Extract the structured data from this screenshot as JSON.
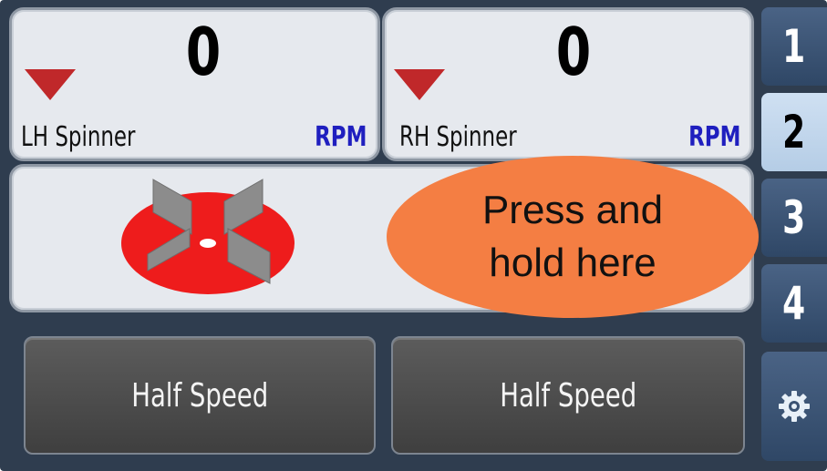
{
  "spinners": {
    "left": {
      "label": "LH Spinner",
      "value": "0",
      "unit": "RPM"
    },
    "right": {
      "label": "RH Spinner",
      "value": "0",
      "unit": "RPM"
    }
  },
  "callout": {
    "line1": "Press and",
    "line2": "hold here"
  },
  "buttons": {
    "left_label": "Half Speed",
    "right_label": "Half Speed"
  },
  "tabs": [
    {
      "label": "1",
      "active": false
    },
    {
      "label": "2",
      "active": true
    },
    {
      "label": "3",
      "active": false
    },
    {
      "label": "4",
      "active": false
    }
  ],
  "icons": {
    "spinner_disc": "spinner-disc-icon",
    "decrease": "down-triangle-icon",
    "settings": "gear-icon"
  },
  "colors": {
    "frame": "#2f3d4f",
    "panel": "#e6e9ee",
    "rpm_unit": "#1f1fbf",
    "indicator_triangle": "#c0282a",
    "disc": "#ee1c1c",
    "callout": "#f47e43",
    "button": "#4a4a4a"
  }
}
